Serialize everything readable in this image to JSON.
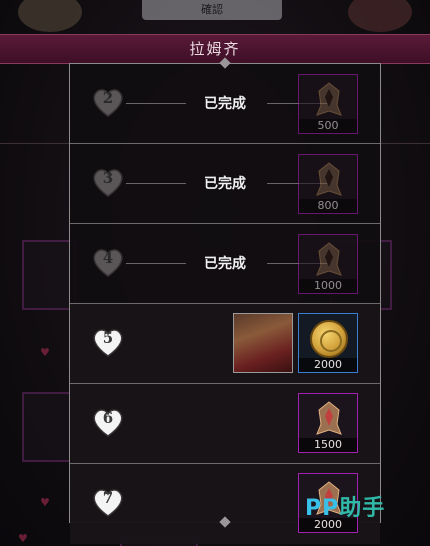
{
  "background": {
    "top_button_label": "確認",
    "banner_title": "拉姆齐"
  },
  "rows": [
    {
      "level": "2",
      "status": "已完成",
      "reward_count": "500"
    },
    {
      "level": "3",
      "status": "已完成",
      "reward_count": "800"
    },
    {
      "level": "4",
      "status": "已完成",
      "reward_count": "1000"
    },
    {
      "level": "5",
      "status": "",
      "reward_count": "2000"
    },
    {
      "level": "6",
      "status": "",
      "reward_count": "1500"
    },
    {
      "level": "7",
      "status": "",
      "reward_count": "2000"
    }
  ],
  "watermark": {
    "prefix": "PP",
    "suffix": "助手"
  },
  "colors": {
    "banner": "#4a1430",
    "reward_border": "#a020b0",
    "coin_border": "#3a7fd0",
    "watermark": "#30b8a8"
  }
}
